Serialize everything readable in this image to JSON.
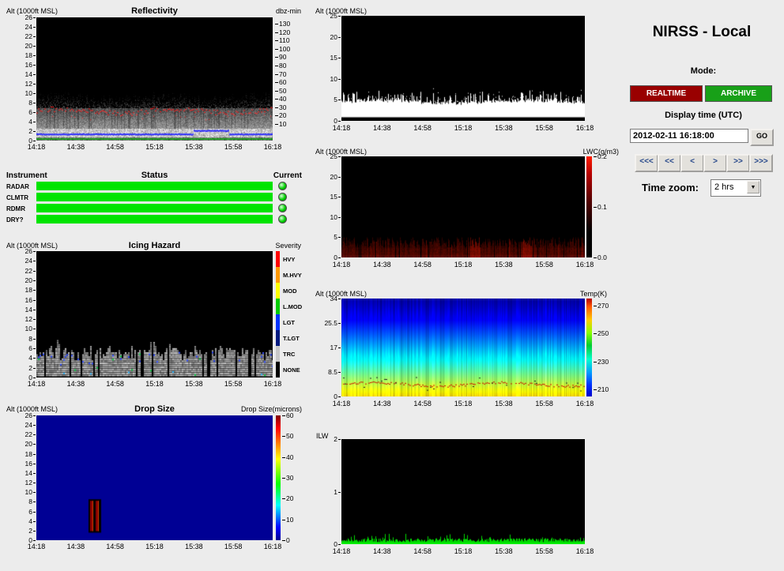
{
  "time_axis": [
    "14:18",
    "14:38",
    "14:58",
    "15:18",
    "15:38",
    "15:58",
    "16:18"
  ],
  "alt_ticks_26": [
    "26",
    "24",
    "22",
    "20",
    "18",
    "16",
    "14",
    "12",
    "10",
    "8",
    "6",
    "4",
    "2",
    "0"
  ],
  "alt_ticks_25": [
    "25",
    "20",
    "15",
    "10",
    "5",
    "0"
  ],
  "panels": {
    "reflectivity": {
      "alt_label": "Alt (1000ft MSL)",
      "title": "Reflectivity",
      "scale_label": "dbz-min",
      "scale_ticks": [
        "130",
        "120",
        "110",
        "100",
        "90",
        "80",
        "70",
        "60",
        "50",
        "40",
        "30",
        "20",
        "10"
      ]
    },
    "status": {
      "instrument_header": "Instrument",
      "title": "Status",
      "current_header": "Current",
      "instruments": [
        "RADAR",
        "CLMTR",
        "RDMR",
        "DRY?"
      ],
      "status_color": "#00e400"
    },
    "icing": {
      "alt_label": "Alt (1000ft MSL)",
      "title": "Icing Hazard",
      "scale_label": "Severity",
      "severity_levels": [
        {
          "label": "HVY",
          "color": "#ff0000"
        },
        {
          "label": "M.HVY",
          "color": "#ff9900"
        },
        {
          "label": "MOD",
          "color": "#ffff00"
        },
        {
          "label": "L.MOD",
          "color": "#00cc00"
        },
        {
          "label": "LGT",
          "color": "#0033ff"
        },
        {
          "label": "T.LGT",
          "color": "#001a80"
        },
        {
          "label": "TRC",
          "color": "#c8c8c8"
        },
        {
          "label": "NONE",
          "color": "#000000"
        }
      ]
    },
    "dropsize": {
      "alt_label": "Alt (1000ft MSL)",
      "title": "Drop Size",
      "scale_label": "Drop Size(microns)",
      "scale_ticks": [
        "60",
        "50",
        "40",
        "30",
        "20",
        "10",
        "0"
      ]
    },
    "cloud": {
      "alt_label": "Alt (1000ft MSL)"
    },
    "lwc": {
      "alt_label": "Alt (1000ft MSL)",
      "scale_label": "LWC(g/m3)",
      "scale_ticks": [
        "0.2",
        "0.1",
        "0.0"
      ]
    },
    "temp": {
      "alt_label": "Alt (1000ft MSL)",
      "scale_label": "Temp(K)",
      "alt_ticks": [
        "34",
        "25.5",
        "17",
        "8.5",
        "0"
      ],
      "scale_ticks": [
        "270",
        "250",
        "230",
        "210"
      ]
    },
    "ilw": {
      "label": "ILW",
      "y_ticks": [
        "2",
        "1",
        "0"
      ]
    }
  },
  "controls": {
    "title": "NIRSS - Local",
    "mode_label": "Mode:",
    "realtime_button": "REALTIME",
    "archive_button": "ARCHIVE",
    "realtime_color": "#990000",
    "archive_color": "#18a018",
    "display_time_label": "Display time (UTC)",
    "display_time_value": "2012-02-11 16:18:00",
    "go_button": "GO",
    "nav_buttons": [
      "<<<",
      "<<",
      "<",
      ">",
      ">>",
      ">>>"
    ],
    "time_zoom_label": "Time zoom:",
    "time_zoom_value": "2 hrs"
  }
}
